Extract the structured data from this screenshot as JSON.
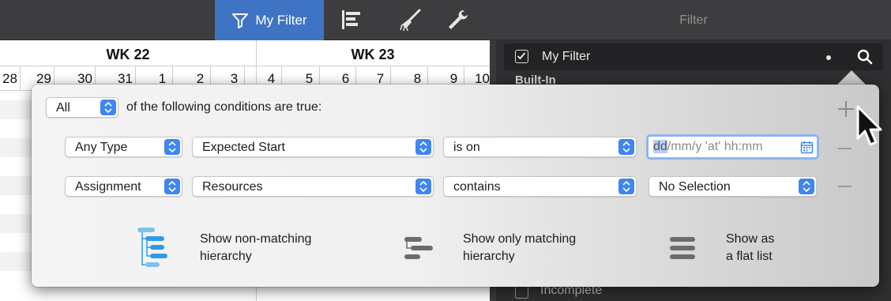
{
  "toolbar": {
    "filter_label": "My Filter",
    "inspector_title": "Filter"
  },
  "gantt": {
    "weeks": [
      "WK 22",
      "WK 23"
    ],
    "days": [
      "28",
      "29",
      "30",
      "31",
      "1",
      "2",
      "3",
      "4",
      "5",
      "6",
      "7",
      "8",
      "9",
      "10"
    ]
  },
  "inspector": {
    "my_filter_label": "My Filter",
    "built_in_label": "Built-In",
    "incomplete_label": "Incomplete"
  },
  "popover": {
    "quantifier": "All",
    "conditions_text": "of the following conditions are true:",
    "rows": [
      {
        "type": "Any Type",
        "field": "Expected Start",
        "operator": "is on",
        "value_placeholder": "dd/mm/y 'at' hh:mm",
        "value_selected": "dd",
        "value_rest": "/mm/y 'at' hh:mm"
      },
      {
        "type": "Assignment",
        "field": "Resources",
        "operator": "contains",
        "value": "No Selection"
      }
    ],
    "options": [
      {
        "line1": "Show non-matching",
        "line2": "hierarchy"
      },
      {
        "line1": "Show only matching",
        "line2": "hierarchy"
      },
      {
        "line1": "Show as",
        "line2": "a flat list"
      }
    ]
  },
  "colors": {
    "accent": "#3f73c4",
    "stepper": "#3f86f0",
    "focus_ring": "#8db4ef"
  }
}
